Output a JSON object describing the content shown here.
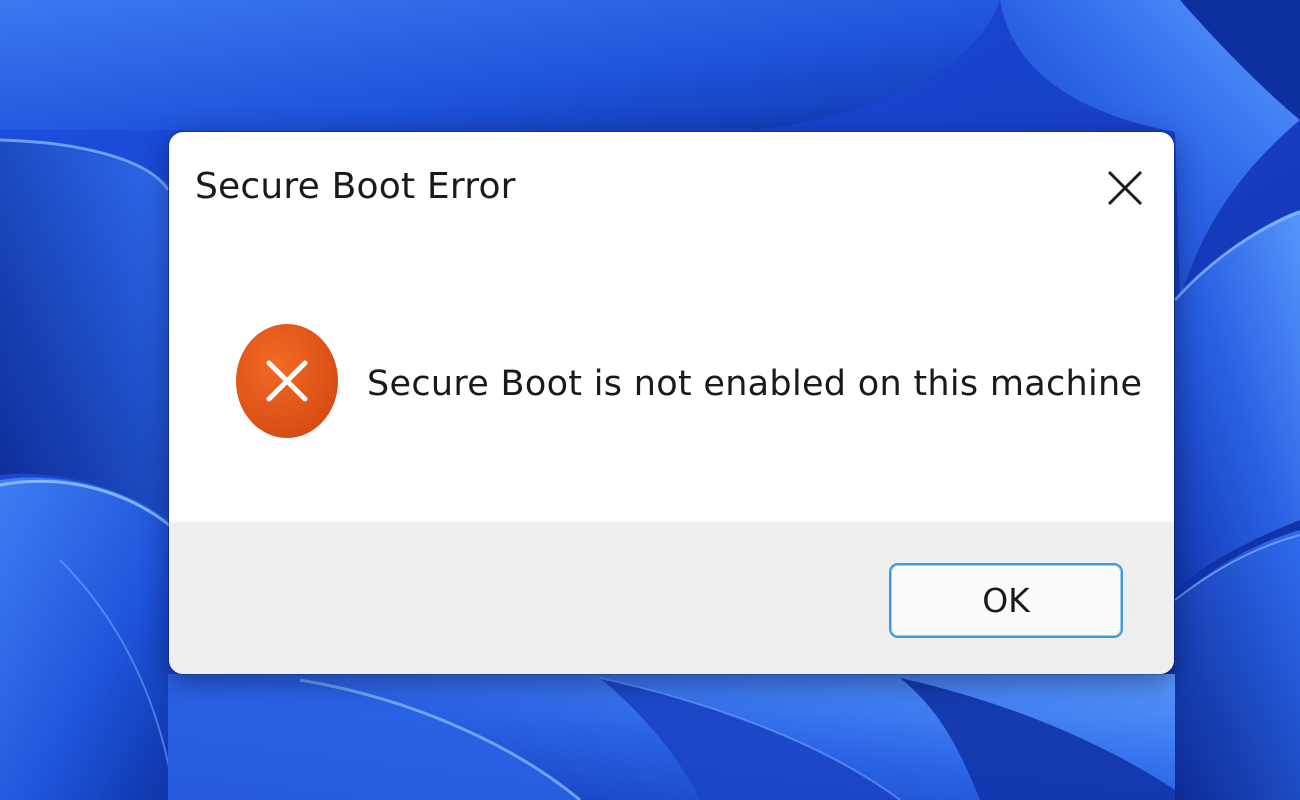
{
  "desktop": {
    "wallpaper": "windows-11-bloom",
    "colors": {
      "deep": "#0b2fa8",
      "base": "#1b47d6",
      "light": "#4a8cf7",
      "highlight": "#8fc2ff"
    }
  },
  "dialog": {
    "title": "Secure Boot Error",
    "close_icon": "close-icon",
    "message_icon": "error-icon",
    "message": "Secure Boot is not enabled on this machine",
    "ok_label": "OK",
    "colors": {
      "error": "#e4571a",
      "focus_border": "#3f9bd8",
      "footer": "#efefef"
    }
  }
}
